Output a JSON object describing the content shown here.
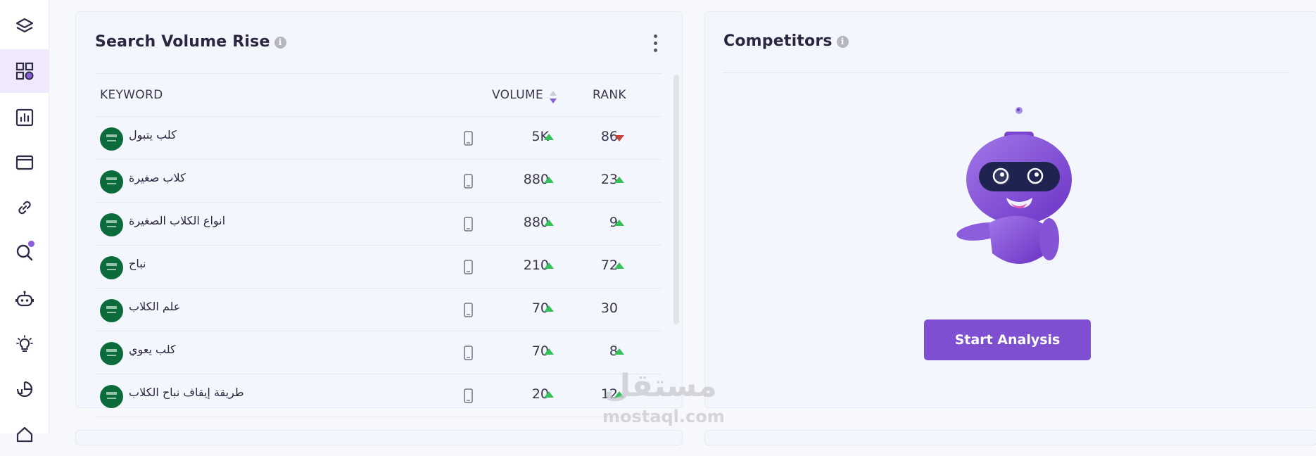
{
  "sidebar": {
    "items": [
      {
        "icon": "layers-icon"
      },
      {
        "icon": "dashboard-icon",
        "active": true
      },
      {
        "icon": "bar-chart-icon"
      },
      {
        "icon": "browser-window-icon"
      },
      {
        "icon": "link-icon"
      },
      {
        "icon": "search-icon",
        "notification": true
      },
      {
        "icon": "robot-icon"
      },
      {
        "icon": "lightbulb-icon"
      },
      {
        "icon": "pie-chart-icon"
      },
      {
        "icon": "home-icon"
      }
    ]
  },
  "search_volume": {
    "title": "Search Volume Rise",
    "info_glyph": "i",
    "columns": {
      "keyword": "KEYWORD",
      "volume": "VOLUME",
      "rank": "RANK"
    },
    "rows": [
      {
        "keyword": "كلب يتبول",
        "volume": "5K",
        "volume_trend": "up",
        "rank": "86",
        "rank_trend": "down"
      },
      {
        "keyword": "كلاب صغيرة",
        "volume": "880",
        "volume_trend": "up",
        "rank": "23",
        "rank_trend": "up"
      },
      {
        "keyword": "انواع الكلاب الصغيرة",
        "volume": "880",
        "volume_trend": "up",
        "rank": "9",
        "rank_trend": "up"
      },
      {
        "keyword": "نباح",
        "volume": "210",
        "volume_trend": "up",
        "rank": "72",
        "rank_trend": "up"
      },
      {
        "keyword": "علم الكلاب",
        "volume": "70",
        "volume_trend": "up",
        "rank": "30",
        "rank_trend": "none"
      },
      {
        "keyword": "كلب يعوي",
        "volume": "70",
        "volume_trend": "up",
        "rank": "8",
        "rank_trend": "up"
      },
      {
        "keyword": "طريقة إيقاف نباح الكلاب",
        "volume": "20",
        "volume_trend": "up",
        "rank": "12",
        "rank_trend": "up"
      }
    ]
  },
  "competitors": {
    "title": "Competitors",
    "info_glyph": "i",
    "button_label": "Start Analysis"
  },
  "watermark": {
    "arabic": "مستقل",
    "latin": "mostaql.com"
  },
  "colors": {
    "accent": "#7e4fd0",
    "up": "#33c15a",
    "down": "#c2443a",
    "active_bg": "#efe9fb"
  }
}
